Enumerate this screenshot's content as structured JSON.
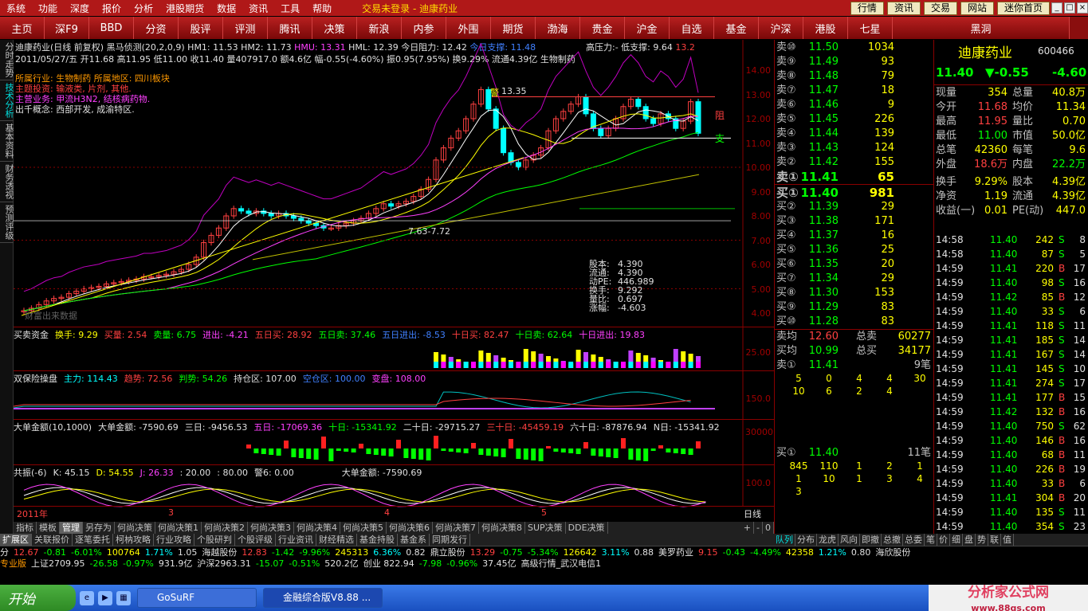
{
  "menubar": {
    "items": [
      "系统",
      "功能",
      "深度",
      "报价",
      "分析",
      "港股期货",
      "数据",
      "资讯",
      "工具",
      "帮助"
    ],
    "title": "交易未登录 - 迪康药业",
    "right_buttons": [
      "行情",
      "资讯",
      "交易",
      "网站",
      "迷你首页"
    ]
  },
  "nav": {
    "buttons": [
      "主页",
      "深F9",
      "BBD",
      "分资",
      "股评",
      "评测",
      "腾讯",
      "决策",
      "新浪",
      "内参",
      "外围",
      "期货",
      "渤海",
      "贵金",
      "沪金",
      "自选",
      "基金",
      "沪深",
      "港股",
      "七星"
    ],
    "last": "黑洞"
  },
  "left_tabs": [
    "分时走势",
    "技术分析",
    "基本资料",
    "财务透视",
    "预测评级"
  ],
  "chart": {
    "line1": {
      "name": "迪康药业(日线 前复权)",
      "ind": "黑马侦测(20,2,0,9)",
      "hm1": "HM1: 11.53",
      "hm2": "HM2: 11.73",
      "hmu": "HMU: 13.31",
      "hml": "HML: 12.39",
      "resist": "今日阻力: 12.42",
      "support": "今日支撑: 11.48",
      "high_low": "高压力:- 低支撑: 9.64",
      "value": "13.2"
    },
    "line2": "2011/05/27/五 开11.68 高11.95 低11.00 收11.40 量407917.0 额4.6亿 幅-0.55(-4.60%) 振0.95(7.95%) 换9.29% 流通4.39亿 生物制药",
    "notes": [
      {
        "text": "所属行业: 生物制药    所属地区: 四川板块",
        "cls": "o"
      },
      {
        "text": "主题投资: 输液类, 片剂, 其他.",
        "cls": "r"
      },
      {
        "text": "主营业务: 甲流H3N2, 结核病药物.",
        "cls": "m"
      },
      {
        "text": "出千概念: 西部开发, 成渝特区.",
        "cls": "w"
      }
    ],
    "price_axis": [
      "14.00",
      "13.00",
      "12.00",
      "11.00",
      "10.00",
      "9.00",
      "8.00",
      "7.00",
      "6.00",
      "5.00",
      "4.00"
    ],
    "labels": {
      "top_price": "13.35",
      "mid_price": "7.63-7.72",
      "resist_char": "阻",
      "support_char": "支",
      "warn": "警",
      "remark": "财富出来数据"
    },
    "overlay": [
      {
        "k": "股本:",
        "v": "4.390"
      },
      {
        "k": "流通:",
        "v": "4.390"
      },
      {
        "k": "动PE:",
        "v": "446.989"
      },
      {
        "k": "换手:",
        "v": "9.292"
      },
      {
        "k": "量比:",
        "v": "0.697"
      },
      {
        "k": "涨幅:",
        "v": "-4.603"
      }
    ],
    "sub1": {
      "title": "买卖资金",
      "items": [
        {
          "t": "换手: 9.29",
          "cls": "y"
        },
        {
          "t": "买量: 2.54",
          "cls": "r"
        },
        {
          "t": "卖量: 6.75",
          "cls": "g"
        },
        {
          "t": "进出: -4.21",
          "cls": "m"
        },
        {
          "t": "五日买: 28.92",
          "cls": "r"
        },
        {
          "t": "五日卖: 37.46",
          "cls": "g"
        },
        {
          "t": "五日进出: -8.53",
          "cls": "b"
        },
        {
          "t": "十日买: 82.47",
          "cls": "r"
        },
        {
          "t": "十日卖: 62.64",
          "cls": "g"
        },
        {
          "t": "十日进出: 19.83",
          "cls": "m"
        }
      ],
      "axis": "25.00"
    },
    "sub2": {
      "title": "双保险操盘",
      "items": [
        {
          "t": "主力: 114.43",
          "cls": "c"
        },
        {
          "t": "趋势: 72.56",
          "cls": "r"
        },
        {
          "t": "判势: 54.26",
          "cls": "g"
        },
        {
          "t": "持仓区: 107.00",
          "cls": "w"
        },
        {
          "t": "空仓区: 100.00",
          "cls": "b"
        },
        {
          "t": "变盘: 108.00",
          "cls": "m"
        }
      ],
      "axis": "150.0"
    },
    "sub3": {
      "title": "大单金额(10,1000)",
      "items": [
        {
          "t": "大单金额: -7590.69",
          "cls": "w"
        },
        {
          "t": "三日: -9456.53",
          "cls": "w"
        },
        {
          "t": "五日: -17069.36",
          "cls": "m"
        },
        {
          "t": "十日: -15341.92",
          "cls": "g"
        },
        {
          "t": "二十日: -29715.27",
          "cls": "w"
        },
        {
          "t": "三十日: -45459.19",
          "cls": "r"
        },
        {
          "t": "六十日: -87876.94",
          "cls": "w"
        },
        {
          "t": "N日: -15341.92",
          "cls": "w"
        }
      ],
      "axis": "30000"
    },
    "sub4": {
      "title": "共振(-6)",
      "items": [
        {
          "t": "K: 45.15",
          "cls": "w"
        },
        {
          "t": "D: 54.55",
          "cls": "y"
        },
        {
          "t": "J: 26.33",
          "cls": "m"
        },
        {
          "t": ": 20.00",
          "cls": "w"
        },
        {
          "t": ": 80.00",
          "cls": "w"
        },
        {
          "t": "警6: 0.00",
          "cls": "w"
        }
      ],
      "extra": "大单金额: -7590.69",
      "axis": "100.0"
    },
    "time_axis": {
      "year": "2011年",
      "m3": "3",
      "m4": "4",
      "m5": "5",
      "period": "日线"
    }
  },
  "tabs_row1": [
    "指标",
    "模板",
    "管理",
    "另存为",
    "何尚决策",
    "何尚决策1",
    "何尚决策2",
    "何尚决策3",
    "何尚决策4",
    "何尚决策5",
    "何尚决策6",
    "何尚决策7",
    "何尚决策8",
    "SUP决策",
    "DDE决策"
  ],
  "tabs_row1_right": [
    "+",
    "-",
    "0"
  ],
  "tabs_row2": [
    "扩展区",
    "关联报价",
    "逐笔委托",
    "柯枘攻略",
    "行业攻略",
    "个股研判",
    "个股评级",
    "行业资讯",
    "财经精选",
    "基金持股",
    "基金系",
    "同期发行"
  ],
  "quote": {
    "sells": [
      {
        "lbl": "卖⑩",
        "px": "11.50",
        "vol": "1034"
      },
      {
        "lbl": "卖⑨",
        "px": "11.49",
        "vol": "93"
      },
      {
        "lbl": "卖⑧",
        "px": "11.48",
        "vol": "79"
      },
      {
        "lbl": "卖⑦",
        "px": "11.47",
        "vol": "18"
      },
      {
        "lbl": "卖⑥",
        "px": "11.46",
        "vol": "9"
      },
      {
        "lbl": "卖⑤",
        "px": "11.45",
        "vol": "226"
      },
      {
        "lbl": "卖④",
        "px": "11.44",
        "vol": "139"
      },
      {
        "lbl": "卖③",
        "px": "11.43",
        "vol": "124"
      },
      {
        "lbl": "卖②",
        "px": "11.42",
        "vol": "155"
      },
      {
        "lbl": "卖①",
        "px": "11.41",
        "vol": "65"
      }
    ],
    "buys": [
      {
        "lbl": "买①",
        "px": "11.40",
        "vol": "981"
      },
      {
        "lbl": "买②",
        "px": "11.39",
        "vol": "29"
      },
      {
        "lbl": "买③",
        "px": "11.38",
        "vol": "171"
      },
      {
        "lbl": "买④",
        "px": "11.37",
        "vol": "16"
      },
      {
        "lbl": "买⑤",
        "px": "11.36",
        "vol": "25"
      },
      {
        "lbl": "买⑥",
        "px": "11.35",
        "vol": "20"
      },
      {
        "lbl": "买⑦",
        "px": "11.34",
        "vol": "29"
      },
      {
        "lbl": "买⑧",
        "px": "11.30",
        "vol": "153"
      },
      {
        "lbl": "买⑨",
        "px": "11.29",
        "vol": "83"
      },
      {
        "lbl": "买⑩",
        "px": "11.28",
        "vol": "83"
      }
    ],
    "avg_sell": {
      "lbl": "卖均",
      "px": "12.60",
      "k": "总卖",
      "v": "60277"
    },
    "avg_buy": {
      "lbl": "买均",
      "px": "10.99",
      "k": "总买",
      "v": "34177"
    },
    "sell1": {
      "lbl": "卖①",
      "px": "11.41",
      "v": "9笔"
    },
    "sell1_orders": [
      "5",
      "0",
      "4",
      "4",
      "30",
      "10",
      "6",
      "2",
      "4"
    ],
    "buy1": {
      "lbl": "买①",
      "px": "11.40",
      "v": "11笔"
    },
    "buy1_orders": [
      "845",
      "110",
      "1",
      "2",
      "1",
      "1",
      "10",
      "1",
      "3",
      "4",
      "3"
    ]
  },
  "rpanel": {
    "name": "迪康药业",
    "code": "600466",
    "price": "11.40",
    "change": "▼-0.55",
    "pct": "-4.60",
    "stats": [
      {
        "k": "现量",
        "v": "354",
        "k2": "总量",
        "v2": "40.8万"
      },
      {
        "k": "今开",
        "v": "11.68",
        "k2": "均价",
        "v2": "11.34"
      },
      {
        "k": "最高",
        "v": "11.95",
        "k2": "量比",
        "v2": "0.70"
      },
      {
        "k": "最低",
        "v": "11.00",
        "k2": "市值",
        "v2": "50.0亿"
      },
      {
        "k": "总笔",
        "v": "42360",
        "k2": "每笔",
        "v2": "9.6"
      },
      {
        "k": "外盘",
        "v": "18.6万",
        "k2": "内盘",
        "v2": "22.2万"
      },
      {
        "k": "换手",
        "v": "9.29%",
        "k2": "股本",
        "v2": "4.39亿"
      },
      {
        "k": "净资",
        "v": "1.19",
        "k2": "流通",
        "v2": "4.39亿"
      },
      {
        "k": "收益(一)",
        "v": "0.01",
        "k2": "PE(动)",
        "v2": "447.0"
      }
    ],
    "ticks": [
      {
        "t": "14:58",
        "p": "11.40",
        "v": "242",
        "s": "S",
        "n": "8"
      },
      {
        "t": "14:58",
        "p": "11.40",
        "v": "87",
        "s": "S",
        "n": "5"
      },
      {
        "t": "14:59",
        "p": "11.41",
        "v": "220",
        "s": "B",
        "n": "17"
      },
      {
        "t": "14:59",
        "p": "11.40",
        "v": "98",
        "s": "S",
        "n": "16"
      },
      {
        "t": "14:59",
        "p": "11.42",
        "v": "85",
        "s": "B",
        "n": "12"
      },
      {
        "t": "14:59",
        "p": "11.40",
        "v": "33",
        "s": "S",
        "n": "6"
      },
      {
        "t": "14:59",
        "p": "11.41",
        "v": "118",
        "s": "S",
        "n": "11"
      },
      {
        "t": "14:59",
        "p": "11.41",
        "v": "185",
        "s": "S",
        "n": "14"
      },
      {
        "t": "14:59",
        "p": "11.41",
        "v": "167",
        "s": "S",
        "n": "14"
      },
      {
        "t": "14:59",
        "p": "11.41",
        "v": "145",
        "s": "S",
        "n": "10"
      },
      {
        "t": "14:59",
        "p": "11.41",
        "v": "274",
        "s": "S",
        "n": "17"
      },
      {
        "t": "14:59",
        "p": "11.41",
        "v": "177",
        "s": "B",
        "n": "15"
      },
      {
        "t": "14:59",
        "p": "11.42",
        "v": "132",
        "s": "B",
        "n": "16"
      },
      {
        "t": "14:59",
        "p": "11.40",
        "v": "750",
        "s": "S",
        "n": "62"
      },
      {
        "t": "14:59",
        "p": "11.40",
        "v": "146",
        "s": "B",
        "n": "16"
      },
      {
        "t": "14:59",
        "p": "11.40",
        "v": "68",
        "s": "B",
        "n": "11"
      },
      {
        "t": "14:59",
        "p": "11.40",
        "v": "226",
        "s": "B",
        "n": "19"
      },
      {
        "t": "14:59",
        "p": "11.40",
        "v": "33",
        "s": "B",
        "n": "6"
      },
      {
        "t": "14:59",
        "p": "11.41",
        "v": "304",
        "s": "B",
        "n": "20"
      },
      {
        "t": "14:59",
        "p": "11.40",
        "v": "135",
        "s": "S",
        "n": "11"
      },
      {
        "t": "14:59",
        "p": "11.40",
        "v": "354",
        "s": "S",
        "n": "23"
      }
    ]
  },
  "rtabs": [
    "队列",
    "分布",
    "龙虎",
    "风向",
    "即撤",
    "总撤",
    "总委",
    "笔",
    "价",
    "细",
    "盘",
    "势",
    "联",
    "值"
  ],
  "indexbar": {
    "line1": [
      {
        "t": "分",
        "cls": "w"
      },
      {
        "t": "12.67",
        "cls": "r"
      },
      {
        "t": "-0.81",
        "cls": "g"
      },
      {
        "t": "-6.01%",
        "cls": "g"
      },
      {
        "t": "100764",
        "cls": "y"
      },
      {
        "t": "1.71%",
        "cls": "c"
      },
      {
        "t": "1.05",
        "cls": "w"
      },
      {
        "t": "海越股份",
        "cls": "w"
      },
      {
        "t": "12.83",
        "cls": "r"
      },
      {
        "t": "-1.42",
        "cls": "g"
      },
      {
        "t": "-9.96%",
        "cls": "g"
      },
      {
        "t": "245313",
        "cls": "y"
      },
      {
        "t": "6.36%",
        "cls": "c"
      },
      {
        "t": "0.82",
        "cls": "w"
      },
      {
        "t": "鼎立股份",
        "cls": "w"
      },
      {
        "t": "13.29",
        "cls": "r"
      },
      {
        "t": "-0.75",
        "cls": "g"
      },
      {
        "t": "-5.34%",
        "cls": "g"
      },
      {
        "t": "126642",
        "cls": "y"
      },
      {
        "t": "3.11%",
        "cls": "c"
      },
      {
        "t": "0.88",
        "cls": "w"
      },
      {
        "t": "美罗药业",
        "cls": "w"
      },
      {
        "t": "9.15",
        "cls": "r"
      },
      {
        "t": "-0.43",
        "cls": "g"
      },
      {
        "t": "-4.49%",
        "cls": "g"
      },
      {
        "t": "42358",
        "cls": "y"
      },
      {
        "t": "1.21%",
        "cls": "c"
      },
      {
        "t": "0.80",
        "cls": "w"
      },
      {
        "t": "海欣股份",
        "cls": "w"
      }
    ],
    "line2": [
      {
        "t": "专业版",
        "cls": "o"
      },
      {
        "t": "上证2709.95",
        "cls": "w"
      },
      {
        "t": "-26.58",
        "cls": "g"
      },
      {
        "t": "-0.97%",
        "cls": "g"
      },
      {
        "t": "931.9亿",
        "cls": "w"
      },
      {
        "t": "沪深2963.31",
        "cls": "w"
      },
      {
        "t": "-15.07",
        "cls": "g"
      },
      {
        "t": "-0.51%",
        "cls": "g"
      },
      {
        "t": "520.2亿",
        "cls": "w"
      },
      {
        "t": "创业 822.94",
        "cls": "w"
      },
      {
        "t": "-7.98",
        "cls": "g"
      },
      {
        "t": "-0.96%",
        "cls": "g"
      },
      {
        "t": "37.45亿",
        "cls": "w"
      },
      {
        "t": "高级行情_武汉电信1",
        "cls": "w"
      }
    ]
  },
  "taskbar": {
    "start": "开始",
    "windows": [
      "GoSuRF",
      "金融综合版V8.88 ..."
    ],
    "brand": "分析家公式网",
    "brand_url": "www.88gs.com"
  },
  "colors": {
    "up": "#ff4040",
    "down": "#00ff00",
    "accent": "#ffff00",
    "panel_red": "#8a0000"
  }
}
